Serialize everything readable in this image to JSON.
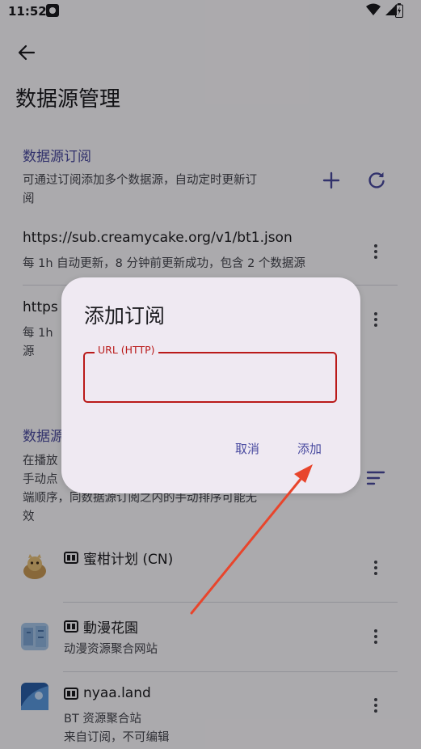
{
  "status_bar": {
    "time": "11:52"
  },
  "header": {
    "title": "数据源管理"
  },
  "subscriptions": {
    "section_title": "数据源订阅",
    "description": "可通过订阅添加多个数据源，自动定时更新订阅",
    "description_lines": [
      "可通过订阅添加多个数据源，自动定时更新订",
      "阅"
    ],
    "items": [
      {
        "url": "https://sub.creamycake.org/v1/bt1.json",
        "status": "每 1h 自动更新，8 分钟前更新成功，包含 2 个数据源"
      },
      {
        "url_visible": "https",
        "status_line1": "每 1h",
        "status_line2": "源"
      }
    ]
  },
  "sources": {
    "section_title_visible": "数据源",
    "description_lines": [
      "在播放",
      "手动点",
      "端顺序，同数据源订阅之内的手动排序可能无",
      "效"
    ],
    "items": [
      {
        "name": "蜜柑计划 (CN)",
        "icon": "mikan-cat-icon"
      },
      {
        "name": "動漫花園",
        "description": "动漫资源聚合网站",
        "icon": "dmhy-icon"
      },
      {
        "name": "nyaa.land",
        "description": "BT 资源聚合站",
        "note": "来自订阅，不可编辑",
        "icon": "nyaa-icon"
      }
    ]
  },
  "dialog": {
    "title": "添加订阅",
    "field_label": "URL (HTTP)",
    "field_value": "",
    "cancel_label": "取消",
    "confirm_label": "添加"
  },
  "colors": {
    "accent": "#4a4ba0",
    "error": "#ba1a1a",
    "annotation_arrow": "#e8452c"
  }
}
